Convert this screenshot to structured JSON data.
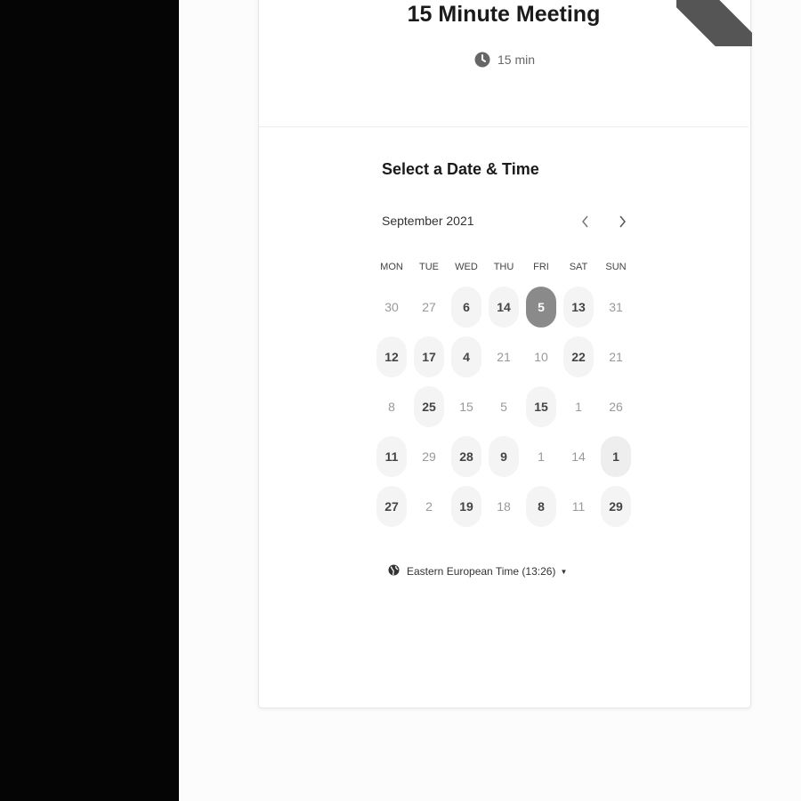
{
  "event": {
    "title": "15 Minute Meeting",
    "duration": "15 min"
  },
  "scheduler": {
    "heading": "Select a Date & Time",
    "month": "September 2021",
    "prev_label": "‹",
    "next_label": "›",
    "weekdays": [
      "MON",
      "TUE",
      "WED",
      "THU",
      "FRI",
      "SAT",
      "SUN"
    ],
    "rows": [
      [
        {
          "label": "30",
          "state": "disabled"
        },
        {
          "label": "27",
          "state": "disabled"
        },
        {
          "label": "6",
          "state": "available"
        },
        {
          "label": "14",
          "state": "available"
        },
        {
          "label": "5",
          "state": "selected"
        },
        {
          "label": "13",
          "state": "available"
        },
        {
          "label": "31",
          "state": "disabled"
        }
      ],
      [
        {
          "label": "12",
          "state": "available"
        },
        {
          "label": "17",
          "state": "available"
        },
        {
          "label": "4",
          "state": "available"
        },
        {
          "label": "21",
          "state": "disabled"
        },
        {
          "label": "10",
          "state": "disabled"
        },
        {
          "label": "22",
          "state": "available"
        },
        {
          "label": "21",
          "state": "disabled"
        }
      ],
      [
        {
          "label": "8",
          "state": "disabled"
        },
        {
          "label": "25",
          "state": "available"
        },
        {
          "label": "15",
          "state": "disabled"
        },
        {
          "label": "5",
          "state": "disabled"
        },
        {
          "label": "15",
          "state": "available"
        },
        {
          "label": "1",
          "state": "disabled"
        },
        {
          "label": "26",
          "state": "disabled"
        }
      ],
      [
        {
          "label": "11",
          "state": "available"
        },
        {
          "label": "29",
          "state": "disabled"
        },
        {
          "label": "28",
          "state": "available"
        },
        {
          "label": "9",
          "state": "available"
        },
        {
          "label": "1",
          "state": "disabled"
        },
        {
          "label": "14",
          "state": "disabled"
        },
        {
          "label": "1",
          "state": "today"
        }
      ],
      [
        {
          "label": "27",
          "state": "available"
        },
        {
          "label": "2",
          "state": "disabled"
        },
        {
          "label": "19",
          "state": "available"
        },
        {
          "label": "18",
          "state": "disabled"
        },
        {
          "label": "8",
          "state": "available"
        },
        {
          "label": "11",
          "state": "disabled"
        },
        {
          "label": "29",
          "state": "available"
        }
      ]
    ],
    "timezone": "Eastern European Time (13:26)"
  },
  "colors": {
    "left_pane": "#050505",
    "selected_day": "#8a8a8a",
    "available_day_bg": "#f4f4f4",
    "ribbon": "#555555"
  },
  "icons": {
    "duration": "clock-icon",
    "timezone": "globe-icon",
    "prev": "chevron-left-icon",
    "next": "chevron-right-icon",
    "timezone_caret": "caret-down-icon"
  }
}
